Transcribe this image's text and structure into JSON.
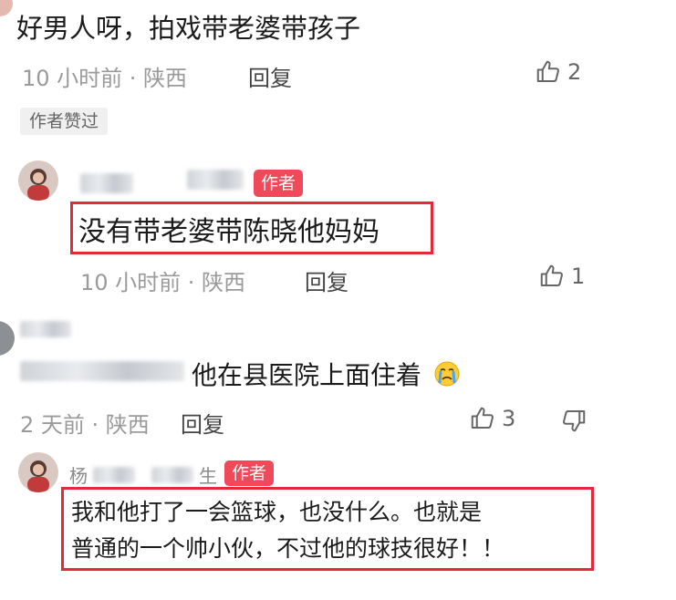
{
  "comment1": {
    "text": "好男人呀，拍戏带老婆带孩子",
    "time_location": "10 小时前 · 陕西",
    "reply_label": "回复",
    "likes": "2",
    "author_liked_tag": "作者赞过"
  },
  "reply1": {
    "author_badge": "作者",
    "text": "没有带老婆带陈晓他妈妈",
    "time_location": "10 小时前 · 陕西",
    "reply_label": "回复",
    "likes": "1"
  },
  "comment2": {
    "text": "他在县医院上面住着",
    "emoji": "crying-face-icon",
    "time_location": "2 天前 · 陕西",
    "reply_label": "回复",
    "likes": "3"
  },
  "reply2": {
    "name_partial_start": "杨",
    "name_partial_end": "生",
    "author_badge": "作者",
    "text_line1": "我和他打了一会篮球，也没什么。也就是",
    "text_line2": "普通的一个帅小伙，不过他的球技很好！！"
  },
  "colors": {
    "highlight_box": "#e6283a",
    "author_badge": "#f04a5a",
    "meta_text": "#9a9a9a"
  }
}
